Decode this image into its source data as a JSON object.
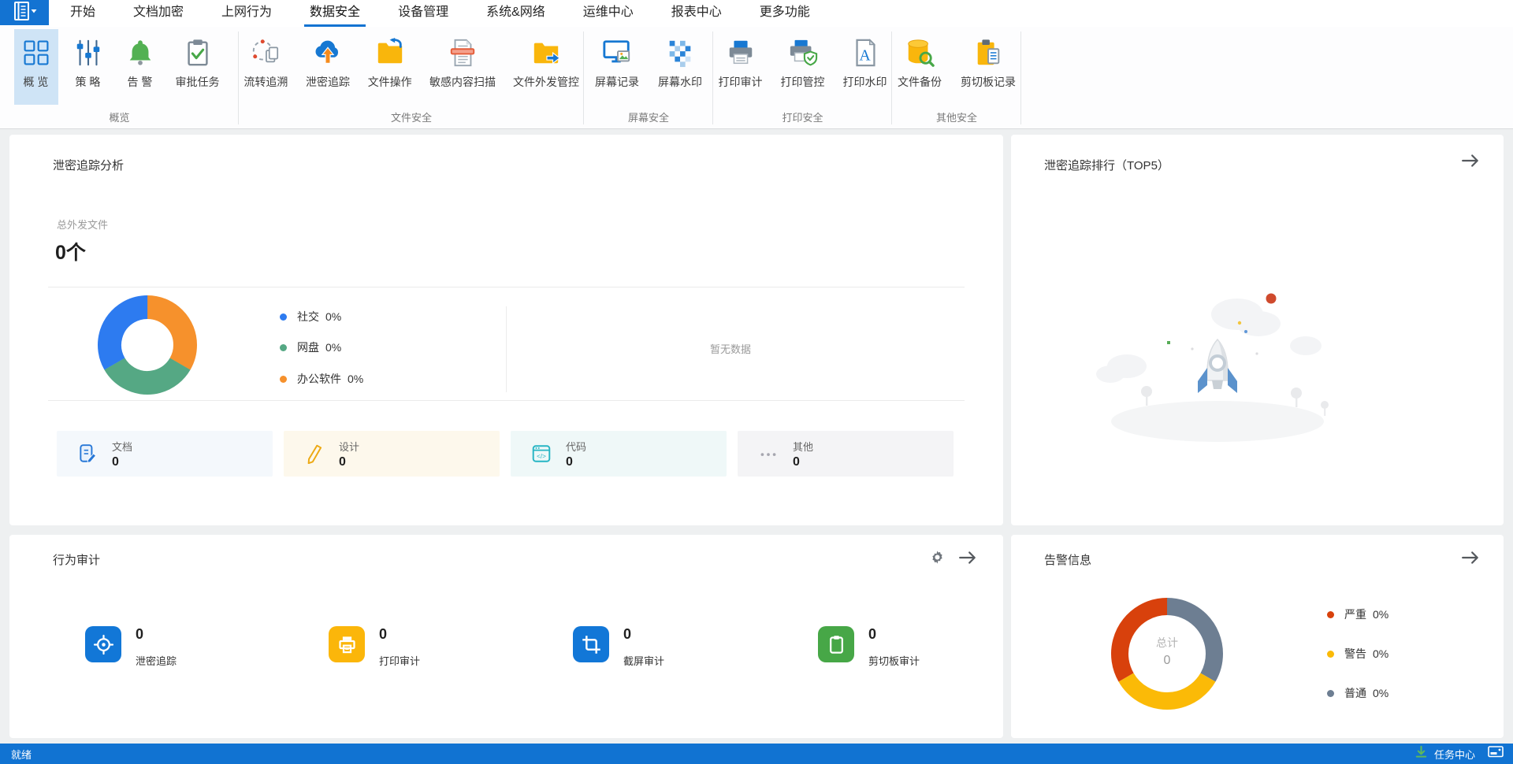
{
  "menu": {
    "tabs": [
      "开始",
      "文档加密",
      "上网行为",
      "数据安全",
      "设备管理",
      "系统&网络",
      "运维中心",
      "报表中心",
      "更多功能"
    ],
    "active_tab": "数据安全",
    "accent_color": "#1373d2"
  },
  "ribbon": {
    "groups": [
      {
        "label": "概览",
        "items": [
          {
            "label": "概 览",
            "icon": "overview-grid-icon",
            "selected": true
          },
          {
            "label": "策 略",
            "icon": "policy-sliders-icon"
          },
          {
            "label": "告 警",
            "icon": "alert-bell-icon"
          },
          {
            "label": "审批任务",
            "icon": "approval-tasks-icon"
          }
        ]
      },
      {
        "label": "文件安全",
        "items": [
          {
            "label": "流转追溯",
            "icon": "flow-trace-icon"
          },
          {
            "label": "泄密追踪",
            "icon": "leak-trace-cloud-icon"
          },
          {
            "label": "文件操作",
            "icon": "file-operation-folder-icon"
          },
          {
            "label": "敏感内容扫描",
            "icon": "sensitive-scan-icon"
          },
          {
            "label": "文件外发管控",
            "icon": "file-outgoing-folder-icon"
          }
        ]
      },
      {
        "label": "屏幕安全",
        "items": [
          {
            "label": "屏幕记录",
            "icon": "screen-record-icon"
          },
          {
            "label": "屏幕水印",
            "icon": "screen-watermark-icon"
          }
        ]
      },
      {
        "label": "打印安全",
        "items": [
          {
            "label": "打印审计",
            "icon": "print-audit-icon"
          },
          {
            "label": "打印管控",
            "icon": "print-control-icon"
          },
          {
            "label": "打印水印",
            "icon": "print-watermark-icon"
          }
        ]
      },
      {
        "label": "其他安全",
        "items": [
          {
            "label": "文件备份",
            "icon": "file-backup-icon"
          },
          {
            "label": "剪切板记录",
            "icon": "clipboard-record-icon"
          }
        ]
      }
    ]
  },
  "cards": {
    "trace_analysis": {
      "title": "泄密追踪分析",
      "total_label": "总外发文件",
      "total_value": "0个",
      "legend": [
        {
          "label": "社交",
          "value": "0%",
          "color": "#2d7bf0"
        },
        {
          "label": "网盘",
          "value": "0%",
          "color": "#55a884"
        },
        {
          "label": "办公软件",
          "value": "0%",
          "color": "#f6912c"
        }
      ],
      "empty_text": "暂无数据",
      "categories": [
        {
          "label": "文档",
          "value": "0",
          "tile_bg": "#f4f8fc",
          "icon_color": "#2878d7"
        },
        {
          "label": "设计",
          "value": "0",
          "tile_bg": "#fdf8ec",
          "icon_color": "#eda913"
        },
        {
          "label": "代码",
          "value": "0",
          "tile_bg": "#eff8f8",
          "icon_color": "#27b5c4"
        },
        {
          "label": "其他",
          "value": "0",
          "tile_bg": "#f4f4f6",
          "icon_color": "#a6a6af"
        }
      ]
    },
    "trace_rank": {
      "title": "泄密追踪排行（TOP5）"
    },
    "behavior_audit": {
      "title": "行为审计",
      "items": [
        {
          "value": "0",
          "label": "泄密追踪",
          "color": "#1277d7"
        },
        {
          "value": "0",
          "label": "打印审计",
          "color": "#fbb60a"
        },
        {
          "value": "0",
          "label": "截屏审计",
          "color": "#1277d7"
        },
        {
          "value": "0",
          "label": "剪切板审计",
          "color": "#47a747"
        }
      ]
    },
    "alerts": {
      "title": "告警信息",
      "center_label": "总计",
      "center_value": "0",
      "legend": [
        {
          "label": "严重",
          "value": "0%",
          "color": "#d8410c"
        },
        {
          "label": "警告",
          "value": "0%",
          "color": "#fbba07"
        },
        {
          "label": "普通",
          "value": "0%",
          "color": "#6d7e92"
        }
      ]
    }
  },
  "chart_data": [
    {
      "type": "pie",
      "donut": true,
      "title": "泄密追踪分析 外发渠道占比",
      "categories": [
        "社交",
        "网盘",
        "办公软件"
      ],
      "values": [
        0,
        0,
        0
      ],
      "value_labels": [
        "0%",
        "0%",
        "0%"
      ],
      "colors": [
        "#f6912c",
        "#55a884",
        "#2d7bf0"
      ],
      "slice_order_from_top_clockwise": [
        "办公软件",
        "网盘",
        "社交"
      ],
      "legend_position": "right"
    },
    {
      "type": "pie",
      "donut": true,
      "title": "告警信息",
      "categories": [
        "严重",
        "警告",
        "普通"
      ],
      "values": [
        0,
        0,
        0
      ],
      "value_labels": [
        "0%",
        "0%",
        "0%"
      ],
      "colors": [
        "#d8410c",
        "#fbba07",
        "#6d7e92"
      ],
      "slice_order_from_top_clockwise": [
        "普通",
        "警告",
        "严重"
      ],
      "center_label": "总计",
      "center_value": "0",
      "legend_position": "right"
    }
  ],
  "statusbar": {
    "ready": "就绪",
    "task_center": "任务中心"
  }
}
